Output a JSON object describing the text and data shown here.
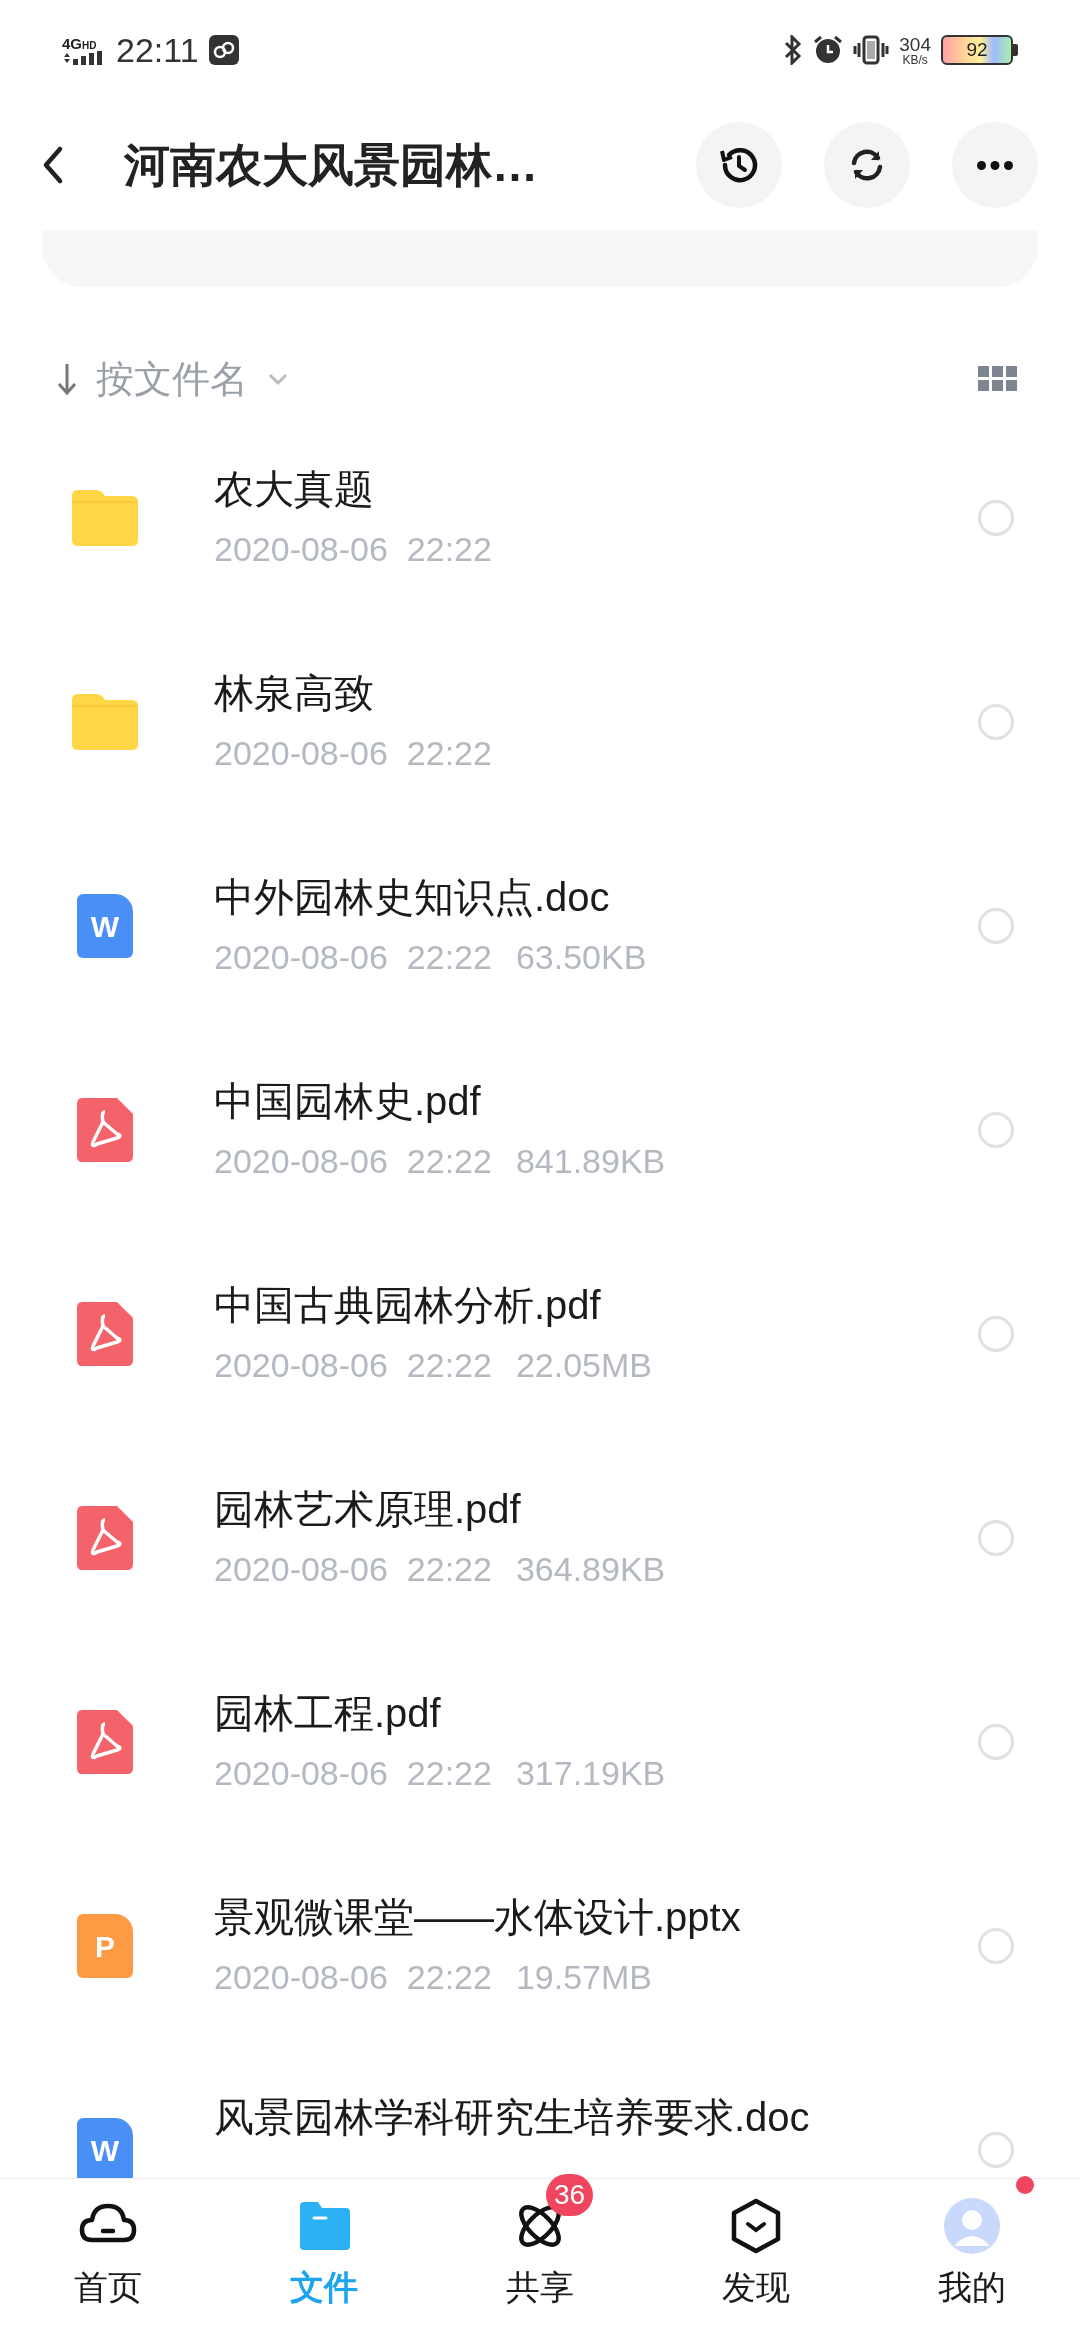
{
  "status_bar": {
    "network": "4G",
    "network_hd": "HD",
    "time": "22:11",
    "speed": "304",
    "speed_unit": "KB/s",
    "battery": "92"
  },
  "header": {
    "title": "河南农大风景园林…"
  },
  "sort": {
    "label": "按文件名"
  },
  "files": [
    {
      "kind": "folder",
      "name": "农大真题",
      "date": "2020-08-06  22:22",
      "selected": false
    },
    {
      "kind": "folder",
      "name": "林泉高致",
      "date": "2020-08-06  22:22",
      "selected": false
    },
    {
      "kind": "doc",
      "icon_text": "W",
      "name": "中外园林史知识点.doc",
      "date": "2020-08-06  22:22",
      "size": "63.50KB",
      "selected": false
    },
    {
      "kind": "pdf",
      "name": "中国园林史.pdf",
      "date": "2020-08-06  22:22",
      "size": "841.89KB",
      "selected": false
    },
    {
      "kind": "pdf",
      "name": "中国古典园林分析.pdf",
      "date": "2020-08-06  22:22",
      "size": "22.05MB",
      "selected": false
    },
    {
      "kind": "pdf",
      "name": "园林艺术原理.pdf",
      "date": "2020-08-06  22:22",
      "size": "364.89KB",
      "selected": false
    },
    {
      "kind": "pdf",
      "name": "园林工程.pdf",
      "date": "2020-08-06  22:22",
      "size": "317.19KB",
      "selected": false
    },
    {
      "kind": "ppt",
      "icon_text": "P",
      "name": "景观微课堂——水体设计.pptx",
      "date": "2020-08-06  22:22",
      "size": "19.57MB",
      "selected": false
    },
    {
      "kind": "doc",
      "icon_text": "W",
      "name": "风景园林学科研究生培养要求.doc",
      "selected": false
    }
  ],
  "nav": [
    {
      "kind": "home",
      "label": "首页",
      "selected": false
    },
    {
      "kind": "files",
      "label": "文件",
      "selected": true
    },
    {
      "kind": "share",
      "label": "共享",
      "selected": false,
      "badge": "36"
    },
    {
      "kind": "discover",
      "label": "发现",
      "selected": false
    },
    {
      "kind": "me",
      "label": "我的",
      "selected": false,
      "dot": true
    }
  ]
}
